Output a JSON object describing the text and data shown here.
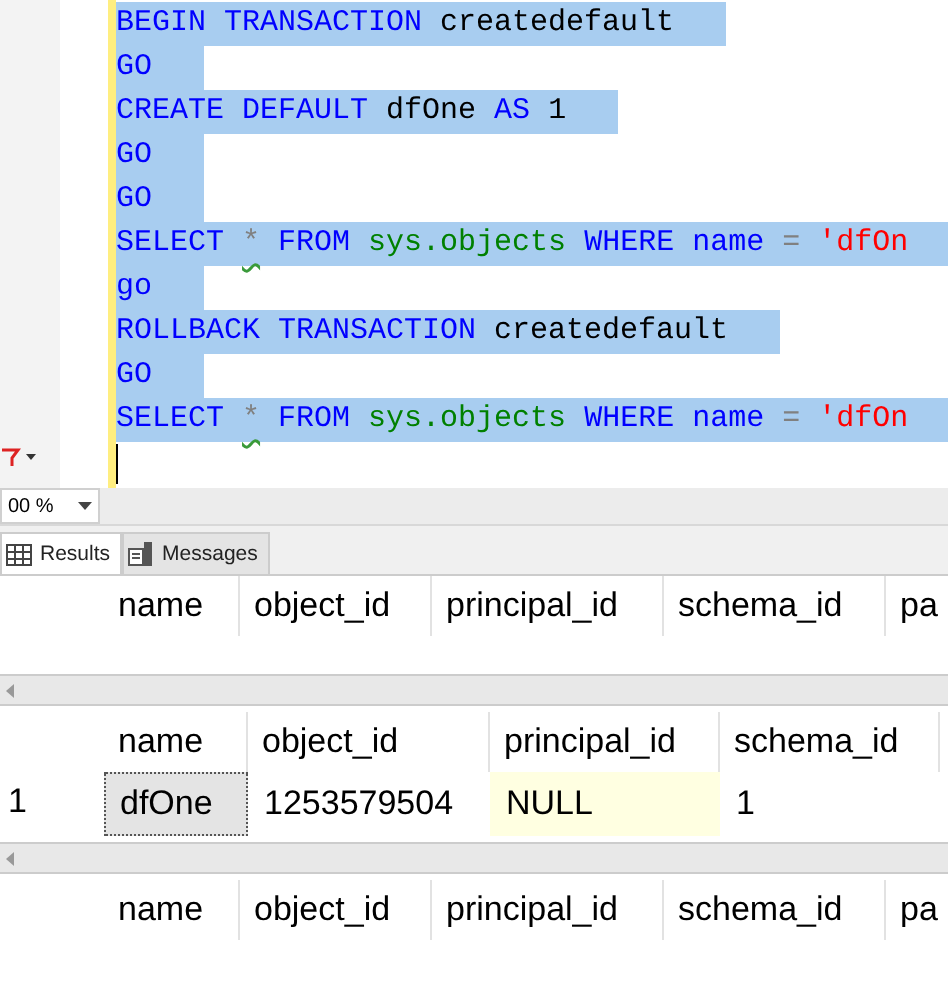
{
  "editor": {
    "lines": [
      {
        "selected": true,
        "tokens": [
          {
            "text": "BEGIN TRANSACTION ",
            "kind": "keyword"
          },
          {
            "text": "createdefault",
            "kind": "plain"
          }
        ]
      },
      {
        "selected": true,
        "tokens": [
          {
            "text": "GO",
            "kind": "keyword"
          }
        ]
      },
      {
        "selected": true,
        "tokens": [
          {
            "text": "CREATE DEFAULT ",
            "kind": "keyword"
          },
          {
            "text": "dfOne ",
            "kind": "plain"
          },
          {
            "text": "AS ",
            "kind": "keyword"
          },
          {
            "text": "1",
            "kind": "plain"
          }
        ]
      },
      {
        "selected": true,
        "tokens": [
          {
            "text": "GO",
            "kind": "keyword"
          }
        ]
      },
      {
        "selected": true,
        "tokens": [
          {
            "text": "GO",
            "kind": "keyword"
          }
        ]
      },
      {
        "selected": true,
        "tokens": [
          {
            "text": "SELECT ",
            "kind": "keyword"
          },
          {
            "text": "*",
            "kind": "warning"
          },
          {
            "text": " FROM ",
            "kind": "keyword"
          },
          {
            "text": "sys.objects",
            "kind": "system"
          },
          {
            "text": " WHERE ",
            "kind": "keyword"
          },
          {
            "text": "name ",
            "kind": "keyword"
          },
          {
            "text": "= ",
            "kind": "operator"
          },
          {
            "text": "'dfOn",
            "kind": "string"
          }
        ]
      },
      {
        "selected": true,
        "tokens": [
          {
            "text": "go",
            "kind": "keyword"
          }
        ]
      },
      {
        "selected": true,
        "tokens": [
          {
            "text": "ROLLBACK TRANSACTION ",
            "kind": "keyword"
          },
          {
            "text": "createdefault",
            "kind": "plain"
          }
        ]
      },
      {
        "selected": true,
        "tokens": [
          {
            "text": "GO",
            "kind": "keyword"
          }
        ]
      },
      {
        "selected": true,
        "tokens": [
          {
            "text": "SELECT ",
            "kind": "keyword"
          },
          {
            "text": "*",
            "kind": "warning"
          },
          {
            "text": " FROM ",
            "kind": "keyword"
          },
          {
            "text": "sys.objects",
            "kind": "system"
          },
          {
            "text": " WHERE ",
            "kind": "keyword"
          },
          {
            "text": "name ",
            "kind": "keyword"
          },
          {
            "text": "= ",
            "kind": "operator"
          },
          {
            "text": "'dfOn",
            "kind": "string"
          }
        ]
      },
      {
        "selected": false
      }
    ]
  },
  "zoom": {
    "value": "00 %"
  },
  "tabs": [
    {
      "label": "Results",
      "selected": true
    },
    {
      "label": "Messages",
      "selected": false
    }
  ],
  "grids": [
    {
      "columns": [
        "name",
        "object_id",
        "principal_id",
        "schema_id",
        "pa"
      ]
    },
    {
      "columns": [
        "name",
        "object_id",
        "principal_id",
        "schema_id"
      ],
      "rows": [
        {
          "number": "1",
          "cells": [
            {
              "text": "dfOne",
              "selected": true,
              "null": false
            },
            {
              "text": "1253579504",
              "selected": false,
              "null": false
            },
            {
              "text": "NULL",
              "selected": false,
              "null": true
            },
            {
              "text": "1",
              "selected": false,
              "null": false
            }
          ]
        }
      ]
    },
    {
      "columns": [
        "name",
        "object_id",
        "principal_id",
        "schema_id",
        "pa"
      ]
    }
  ]
}
